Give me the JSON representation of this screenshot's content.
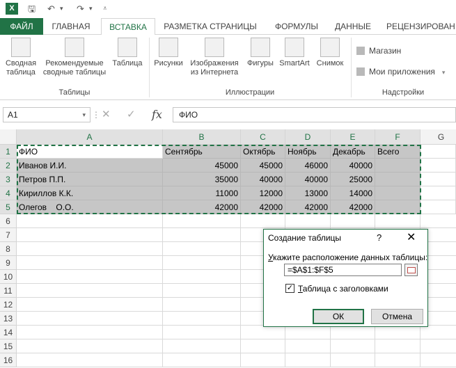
{
  "app": {
    "logo": "X"
  },
  "quick_access": {
    "save_icon": "save-icon",
    "undo_icon": "undo-icon",
    "redo_icon": "redo-icon",
    "customize_icon": "customize-icon"
  },
  "tabs": [
    {
      "label": "ФАЙЛ"
    },
    {
      "label": "ГЛАВНАЯ"
    },
    {
      "label": "ВСТАВКА"
    },
    {
      "label": "РАЗМЕТКА СТРАНИЦЫ"
    },
    {
      "label": "ФОРМУЛЫ"
    },
    {
      "label": "ДАННЫЕ"
    },
    {
      "label": "РЕЦЕНЗИРОВАН"
    }
  ],
  "ribbon": {
    "tables_group": "Таблицы",
    "illustrations_group": "Иллюстрации",
    "addins_group": "Надстройки",
    "pivot_l1": "Сводная",
    "pivot_l2": "таблица",
    "recommended_l1": "Рекомендуемые",
    "recommended_l2": "сводные таблицы",
    "table": "Таблица",
    "pictures": "Рисунки",
    "online_l1": "Изображения",
    "online_l2": "из Интернета",
    "shapes": "Фигуры",
    "smartart": "SmartArt",
    "screenshot": "Снимок",
    "store": "Магазин",
    "my_apps": "Мои приложения"
  },
  "formula_bar": {
    "name_box": "A1",
    "formula": "ФИО",
    "fx": "fx",
    "cancel": "✕",
    "enter": "✓",
    "dots": "⋮"
  },
  "grid": {
    "columns": [
      "A",
      "B",
      "C",
      "D",
      "E",
      "F",
      "G"
    ],
    "rows": [
      "1",
      "2",
      "3",
      "4",
      "5",
      "6",
      "7",
      "8",
      "9",
      "10",
      "11",
      "12",
      "13",
      "14",
      "15",
      "16"
    ],
    "cells": {
      "a1": "ФИО",
      "b1": "Сентябрь",
      "c1": "Октябрь",
      "d1": "Ноябрь",
      "e1": "Декабрь",
      "f1": "Всего",
      "a2": "Иванов И.И.",
      "b2": "45000",
      "c2": "45000",
      "d2": "46000",
      "e2": "40000",
      "a3": "Петров П.П.",
      "b3": "35000",
      "c3": "40000",
      "d3": "40000",
      "e3": "25000",
      "a4": "Кириллов К.К.",
      "b4": "11000",
      "c4": "12000",
      "d4": "13000",
      "e4": "14000",
      "a5": "Олегов    О.О.",
      "b5": "42000",
      "c5": "42000",
      "d5": "42000",
      "e5": "42000"
    }
  },
  "dialog": {
    "title": "Создание таблицы",
    "help": "?",
    "close": "✕",
    "label_u": "У",
    "label_rest": "кажите расположение данных таблицы:",
    "range": "=$A$1:$F$5",
    "checkbox_mark": "✓",
    "checkbox_u": "Т",
    "checkbox_rest": "аблица с заголовками",
    "ok": "ОК",
    "cancel": "Отмена"
  }
}
